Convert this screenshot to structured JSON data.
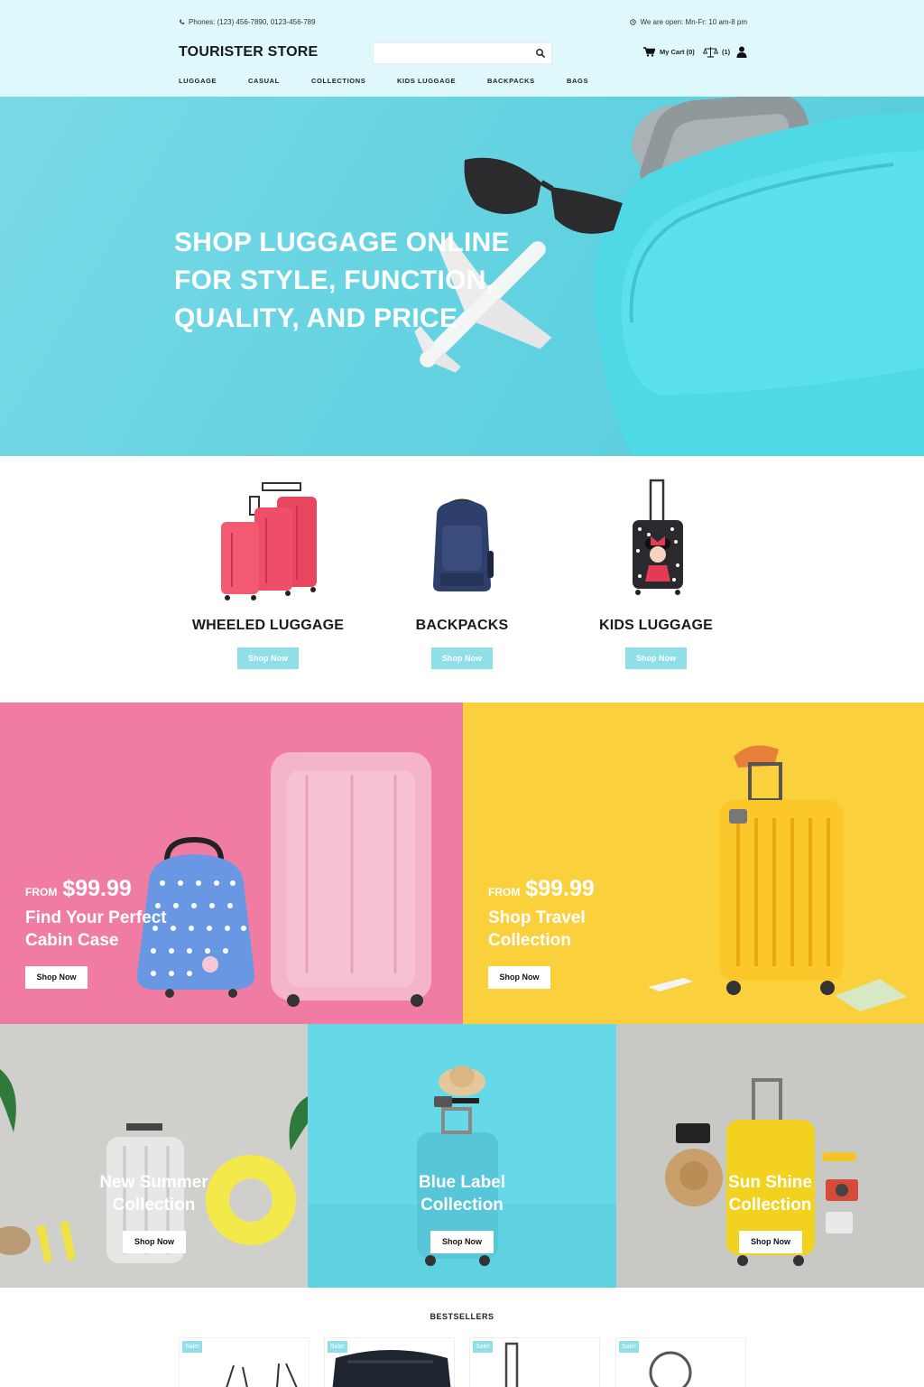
{
  "header": {
    "phone_text": "Phones: (123) 456-7890, 0123-456-789",
    "hours_text": "We are open: Mn-Fr: 10 am-8 pm",
    "logo": "TOURISTER STORE",
    "search": {
      "placeholder": "",
      "value": ""
    },
    "cart_label": "My Cart (0)",
    "compare_count": "(1)",
    "nav": [
      "LUGGAGE",
      "CASUAL",
      "COLLECTIONS",
      "KIDS LUGGAGE",
      "BACKPACKS",
      "BAGS"
    ]
  },
  "hero": {
    "lines": [
      "SHOP LUGGAGE ONLINE",
      "FOR STYLE, FUNCTION,",
      "QUALITY, AND PRICE"
    ]
  },
  "categories": [
    {
      "name": "WHEELED LUGGAGE",
      "button": "Shop Now"
    },
    {
      "name": "BACKPACKS",
      "button": "Shop Now"
    },
    {
      "name": "KIDS LUGGAGE",
      "button": "Shop Now"
    }
  ],
  "promos": [
    {
      "from_label": "FROM",
      "price": "$99.99",
      "title_1": "Find Your Perfect",
      "title_2": "Cabin Case",
      "button": "Shop Now",
      "bg": "#f07ca3"
    },
    {
      "from_label": "FROM",
      "price": "$99.99",
      "title_1": "Shop Travel",
      "title_2": "Collection",
      "button": "Shop Now",
      "bg": "#fbd03d"
    }
  ],
  "collections": [
    {
      "title_1": "New Summer",
      "title_2": "Collection",
      "button": "Shop Now",
      "bg": "#cfcfcc"
    },
    {
      "title_1": "Blue Label",
      "title_2": "Collection",
      "button": "Shop Now",
      "bg": "#66d9e8"
    },
    {
      "title_1": "Sun Shine",
      "title_2": "Collection",
      "button": "Shop Now",
      "bg": "#c8c8c5"
    }
  ],
  "bestsellers": {
    "title": "BESTSELLERS",
    "products": [
      {
        "badge": "Sale!"
      },
      {
        "badge": "Sale!"
      },
      {
        "badge": "Sale!"
      },
      {
        "badge": "Sale!"
      }
    ]
  },
  "colors": {
    "accent": "#8fdfe8",
    "header_bg": "#dff8fb",
    "hero_bg": "#62d2e1"
  }
}
